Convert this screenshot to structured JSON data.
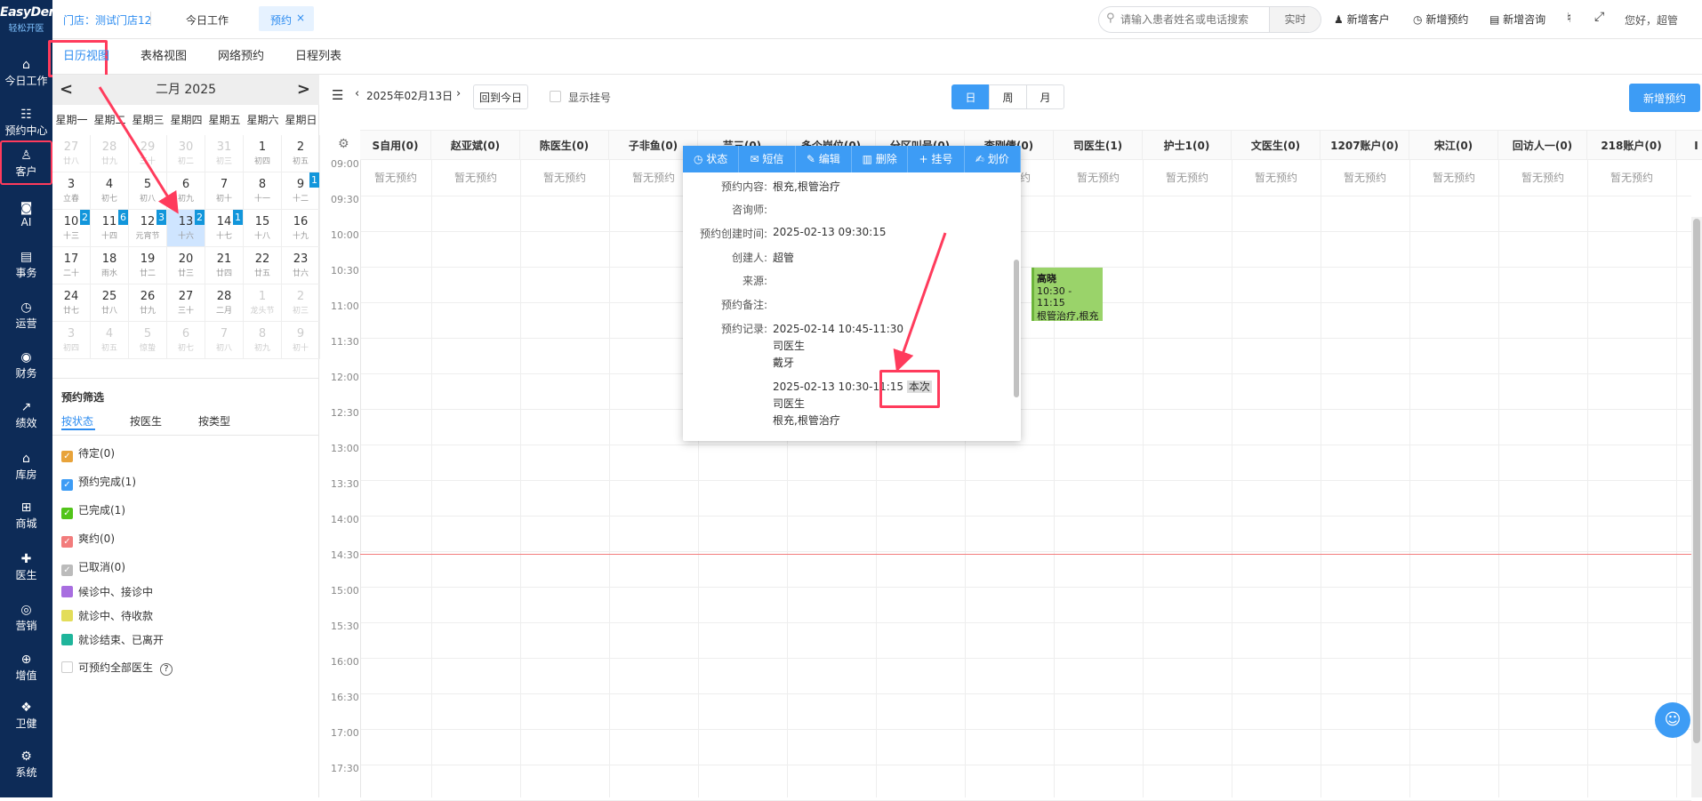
{
  "sidebar": {
    "logo_main": "EasyDent",
    "logo_sub": "轻松开医",
    "items": [
      {
        "label": "今日工作",
        "icon": "home-icon"
      },
      {
        "label": "预约中心",
        "icon": "calendar-icon"
      },
      {
        "label": "客户",
        "icon": "user-icon"
      },
      {
        "label": "AI",
        "icon": "ai-icon"
      },
      {
        "label": "事务",
        "icon": "task-icon"
      },
      {
        "label": "运营",
        "icon": "clock-icon"
      },
      {
        "label": "财务",
        "icon": "money-icon"
      },
      {
        "label": "绩效",
        "icon": "chart-icon"
      },
      {
        "label": "库房",
        "icon": "warehouse-icon"
      },
      {
        "label": "商城",
        "icon": "cart-icon"
      },
      {
        "label": "医生",
        "icon": "doctor-icon"
      },
      {
        "label": "营销",
        "icon": "marketing-icon"
      },
      {
        "label": "增值",
        "icon": "plus-icon"
      },
      {
        "label": "卫健",
        "icon": "health-icon"
      },
      {
        "label": "系统",
        "icon": "gear-icon"
      }
    ]
  },
  "topbar": {
    "store": "门店：测试门店12",
    "tab_today": "今日工作",
    "tab_appt": "预约",
    "tab_close": "×",
    "search_placeholder": "请输入患者姓名或电话搜索",
    "realtime": "实时",
    "new_customer": "新增客户",
    "new_appt": "新增预约",
    "new_consult": "新增咨询",
    "greeting": "您好，超管"
  },
  "subtabs": [
    "日历视图",
    "表格视图",
    "网络预约",
    "日程列表"
  ],
  "calendar": {
    "month_title": "二月 2025",
    "prev": "<",
    "next": ">",
    "weekdays": [
      "星期一",
      "星期二",
      "星期三",
      "星期四",
      "星期五",
      "星期六",
      "星期日"
    ],
    "days": [
      {
        "n": "27",
        "l": "廿八",
        "o": true
      },
      {
        "n": "28",
        "l": "廿九",
        "o": true
      },
      {
        "n": "29",
        "l": "三十",
        "o": true
      },
      {
        "n": "30",
        "l": "初二",
        "o": true
      },
      {
        "n": "31",
        "l": "初三",
        "o": true
      },
      {
        "n": "1",
        "l": "初四"
      },
      {
        "n": "2",
        "l": "初五"
      },
      {
        "n": "3",
        "l": "立春"
      },
      {
        "n": "4",
        "l": "初七"
      },
      {
        "n": "5",
        "l": "初八"
      },
      {
        "n": "6",
        "l": "初九"
      },
      {
        "n": "7",
        "l": "初十"
      },
      {
        "n": "8",
        "l": "十一"
      },
      {
        "n": "9",
        "l": "十二",
        "b": "1"
      },
      {
        "n": "10",
        "l": "十三",
        "b": "2"
      },
      {
        "n": "11",
        "l": "十四",
        "b": "6"
      },
      {
        "n": "12",
        "l": "元宵节",
        "b": "3"
      },
      {
        "n": "13",
        "l": "十六",
        "b": "2",
        "s": true
      },
      {
        "n": "14",
        "l": "十七",
        "b": "1"
      },
      {
        "n": "15",
        "l": "十八"
      },
      {
        "n": "16",
        "l": "十九"
      },
      {
        "n": "17",
        "l": "二十"
      },
      {
        "n": "18",
        "l": "雨水"
      },
      {
        "n": "19",
        "l": "廿二"
      },
      {
        "n": "20",
        "l": "廿三"
      },
      {
        "n": "21",
        "l": "廿四"
      },
      {
        "n": "22",
        "l": "廿五"
      },
      {
        "n": "23",
        "l": "廿六"
      },
      {
        "n": "24",
        "l": "廿七"
      },
      {
        "n": "25",
        "l": "廿八"
      },
      {
        "n": "26",
        "l": "廿九"
      },
      {
        "n": "27",
        "l": "三十"
      },
      {
        "n": "28",
        "l": "二月"
      },
      {
        "n": "1",
        "l": "龙头节",
        "o": true
      },
      {
        "n": "2",
        "l": "初三",
        "o": true
      },
      {
        "n": "3",
        "l": "初四",
        "o": true
      },
      {
        "n": "4",
        "l": "初五",
        "o": true
      },
      {
        "n": "5",
        "l": "惊蛰",
        "o": true
      },
      {
        "n": "6",
        "l": "初七",
        "o": true
      },
      {
        "n": "7",
        "l": "初八",
        "o": true
      },
      {
        "n": "8",
        "l": "初九",
        "o": true
      },
      {
        "n": "9",
        "l": "初十",
        "o": true
      }
    ]
  },
  "filter": {
    "title": "预约筛选",
    "tabs": [
      "按状态",
      "按医生",
      "按类型"
    ],
    "items": [
      {
        "label": "待定(0)",
        "color": "#e8a33a",
        "checked": true
      },
      {
        "label": "预约完成(1)",
        "color": "#3d9cf5",
        "checked": true
      },
      {
        "label": "已完成(1)",
        "color": "#52c41a",
        "checked": true
      },
      {
        "label": "爽约(0)",
        "color": "#f27c7c",
        "checked": true
      },
      {
        "label": "已取消(0)",
        "color": "#bbbbbb",
        "checked": true
      },
      {
        "label": "候诊中、接诊中",
        "color": "#a86ee0",
        "checked": false
      },
      {
        "label": "就诊中、待收款",
        "color": "#e3dd5a",
        "checked": false
      },
      {
        "label": "就诊结束、已离开",
        "color": "#1fb59b",
        "checked": false
      }
    ],
    "all_doctors": "可预约全部医生",
    "help": "?"
  },
  "toolbar": {
    "date": "2025年02月13日",
    "today_btn": "回到今日",
    "show_reg": "显示挂号",
    "view_day": "日",
    "view_week": "周",
    "view_month": "月",
    "new_appt_btn": "新增预约"
  },
  "columns": [
    "S自用(0)",
    "赵亚斌(0)",
    "陈医生(0)",
    "子非鱼(0)",
    "芸三(0)",
    "多个岗位(0)",
    "分区叫号(0)",
    "李刚倩(0)",
    "司医生(1)",
    "护士1(0)",
    "文医生(0)",
    "1207账户(0)",
    "宋江(0)",
    "回访人一(0)",
    "218账户(0)",
    "I"
  ],
  "no_appt": "暂无预约",
  "times": [
    "09:00",
    "09:30",
    "10:00",
    "10:30",
    "11:00",
    "11:30",
    "12:00",
    "12:30",
    "13:00",
    "13:30",
    "14:00",
    "14:30",
    "15:00",
    "15:30",
    "16:00",
    "16:30",
    "17:00",
    "17:30"
  ],
  "appointment": {
    "name": "高晓",
    "time": "10:30 - 11:15",
    "desc": "根管治疗,根充"
  },
  "popup": {
    "actions": [
      "状态",
      "短信",
      "编辑",
      "删除",
      "挂号",
      "划价"
    ],
    "content_label": "预约内容:",
    "content_value": "根充,根管治疗",
    "consultant_label": "咨询师:",
    "created_label": "预约创建时间:",
    "created_value": "2025-02-13 09:30:15",
    "creator_label": "创建人:",
    "creator_value": "超管",
    "source_label": "来源:",
    "note_label": "预约备注:",
    "record_label": "预约记录:",
    "records": [
      {
        "time": "2025-02-14 10:45-11:30",
        "doctor": "司医生",
        "item": "戴牙",
        "tag": ""
      },
      {
        "time": "2025-02-13 10:30-11:15",
        "doctor": "司医生",
        "item": "根充,根管治疗",
        "tag": "本次"
      }
    ]
  }
}
